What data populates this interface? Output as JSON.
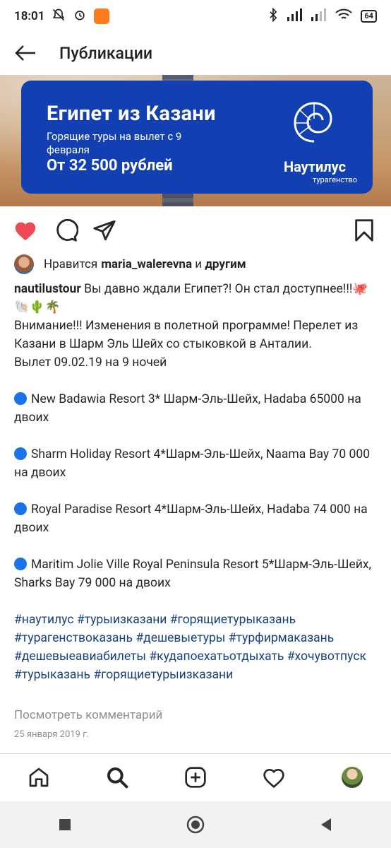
{
  "status_bar": {
    "time": "18:01",
    "battery": "64"
  },
  "app_bar": {
    "title": "Публикации"
  },
  "ad": {
    "title": "Египет из Казани",
    "subtitle": "Горящие туры на вылет с 9 февраля",
    "price": "От 32 500 рублей",
    "brand": "Наутилус",
    "brand_sub": "турагенство"
  },
  "post": {
    "likes_prefix": "Нравится ",
    "likes_user": "maria_walerevna",
    "likes_middle": " и ",
    "likes_suffix": "другим",
    "author": "nautilustour",
    "intro": " Вы давно ждали Египет?! Он стал доступнее!!!🐙🐚🌵🌴",
    "line2": "Внимание!!! Изменения в полетной программе! Перелет из Казани в Шарм Эль Шейх со стыковкой в Анталии.",
    "line3": "Вылет 09.02.19 на 9 ночей",
    "offers": [
      "New Badawia Resort 3* Шарм-Эль-Шейх, Hadaba 65000 на двоих",
      "Sharm Holiday Resort 4*Шарм-Эль-Шейх, Naama Bay 70 000 на двоих",
      "Royal Paradise Resort 4*Шарм-Эль-Шейх, Hadaba 74 000 на двоих",
      "Maritim Jolie Ville Royal Peninsula Resort 5*Шарм-Эль-Шейх, Sharks Bay 79 000 на двоих"
    ],
    "hashtags": [
      "#наутилус",
      "#турыизказани",
      "#горящиетурыказань",
      "#турагенствоказань",
      "#дешевыетуры",
      "#турфирмаказань",
      "#дешевыеавиабилеты",
      "#кудапоехатьотдыхать",
      "#хочувотпуск",
      "#турыказань",
      "#горящиетурыизказани"
    ],
    "view_comments": "Посмотреть комментарий",
    "date": "25 января 2019 г."
  },
  "colors": {
    "accent_like": "#ed4956",
    "ad_blue": "#1240b3",
    "hashtag": "#17427a"
  }
}
